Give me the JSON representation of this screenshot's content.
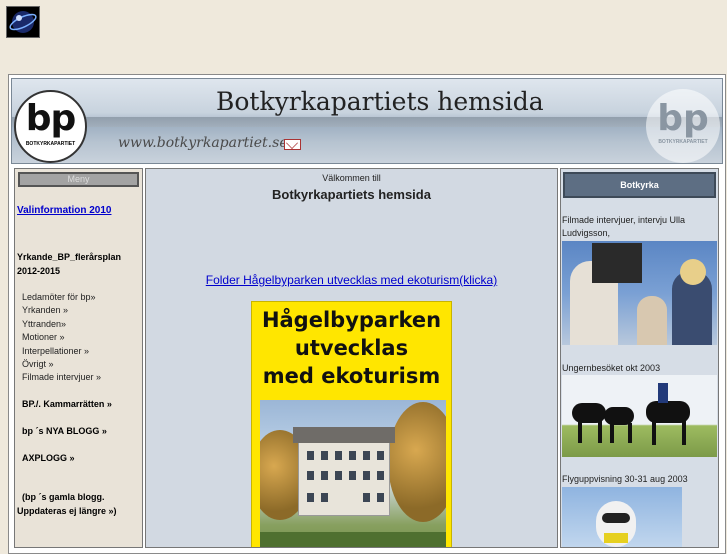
{
  "header": {
    "banner_title": "Botkyrkapartiets hemsida",
    "banner_url": "www.botkyrkapartiet.se",
    "logo_text": "bp",
    "logo_sub": "BOTKYRKAPARTIET"
  },
  "left_menu": {
    "meny_label": "Meny",
    "valinformation": "Valinformation 2010",
    "yrkande_line1": "Yrkande_BP_flerårsplan",
    "yrkande_line2": "2012-2015",
    "items": [
      "Ledamöter för bp»",
      "Yrkanden »",
      "Yttranden»",
      "Motioner »",
      "Interpellationer »",
      "Övrigt »",
      "Filmade intervjuer »"
    ],
    "kammarratten": "BP./. Kammarrätten »",
    "nya_blogg": "bp ´s NYA BLOGG »",
    "axplogg": "AXPLOGG »",
    "gamla_blogg_line1": "(bp ´s gamla blogg.",
    "gamla_blogg_line2": "Uppdateras ej längre »)"
  },
  "main": {
    "welcome": "Välkommen till",
    "title": "Botkyrkapartiets hemsida",
    "folder_link": "Folder Hågelbyparken utvecklas med ekoturism(klicka)",
    "poster_title_1": "Hågelbyparken",
    "poster_title_2": "utvecklas",
    "poster_title_3": "med ekoturism"
  },
  "right_col": {
    "button": "Botkyrka",
    "caption1": "Filmade intervjuer, intervju Ulla Ludvigsson,",
    "caption2": "Ungernbesöket okt 2003",
    "caption3": "Flyguppvisning 30-31 aug 2003"
  },
  "colors": {
    "page_bg": "#efe9dc",
    "link": "#0000cc",
    "poster_yellow": "#ffe600",
    "right_button": "#5d6e83"
  }
}
